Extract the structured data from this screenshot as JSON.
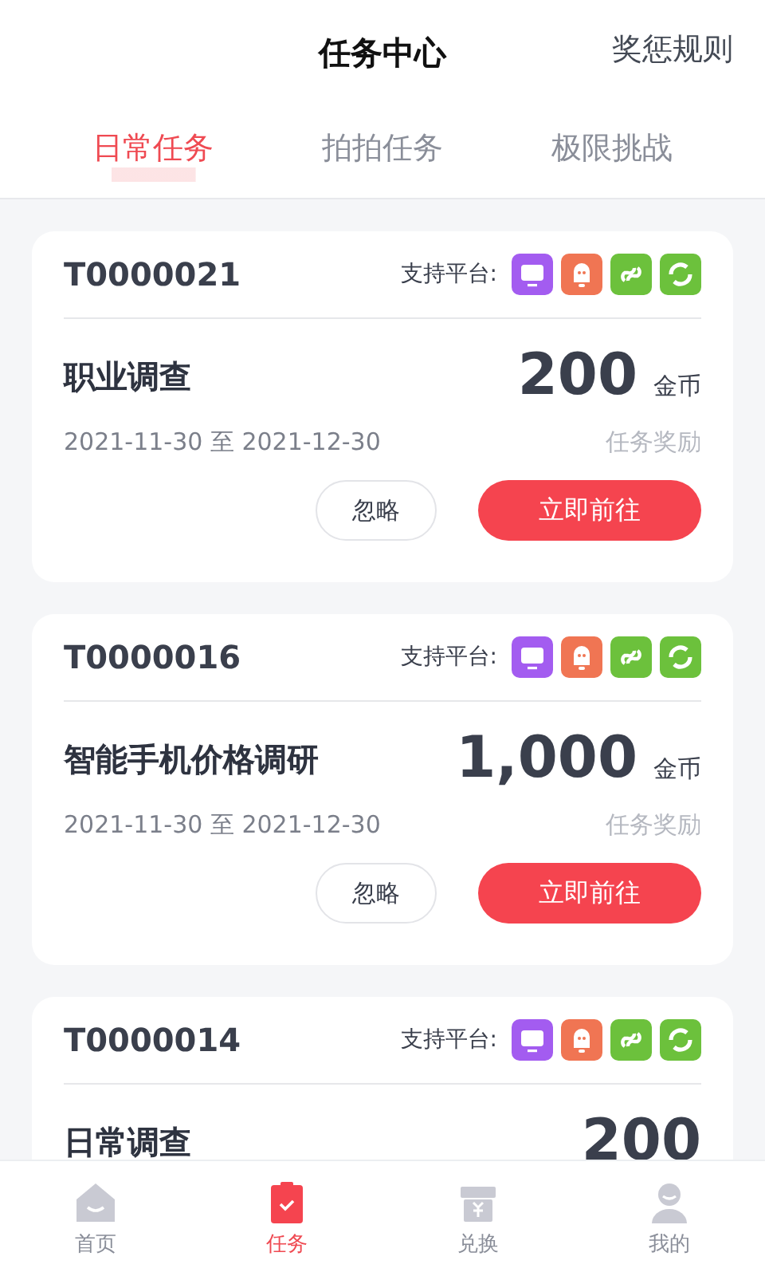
{
  "header": {
    "title": "任务中心",
    "action": "奖惩规则"
  },
  "tabs": [
    {
      "label": "日常任务",
      "selected": true
    },
    {
      "label": "拍拍任务",
      "selected": false
    },
    {
      "label": "极限挑战",
      "selected": false
    }
  ],
  "tasks": [
    {
      "id": "T0000021",
      "platforms_label": "支持平台:",
      "title": "职业调查",
      "amount": "200",
      "unit": "金币",
      "dates": "2021-11-30 至 2021-12-30",
      "reward_label": "任务奖励",
      "ignore": "忽略",
      "go": "立即前往"
    },
    {
      "id": "T0000016",
      "platforms_label": "支持平台:",
      "title": "智能手机价格调研",
      "amount": "1,000",
      "unit": "金币",
      "dates": "2021-11-30 至 2021-12-30",
      "reward_label": "任务奖励",
      "ignore": "忽略",
      "go": "立即前往"
    },
    {
      "id": "T0000014",
      "platforms_label": "支持平台:",
      "title": "日常调查",
      "amount": "200"
    }
  ],
  "nav": [
    {
      "label": "首页",
      "kind": "home",
      "selected": false
    },
    {
      "label": "任务",
      "kind": "task",
      "selected": true
    },
    {
      "label": "兑换",
      "kind": "gift",
      "selected": false
    },
    {
      "label": "我的",
      "kind": "user",
      "selected": false
    }
  ]
}
